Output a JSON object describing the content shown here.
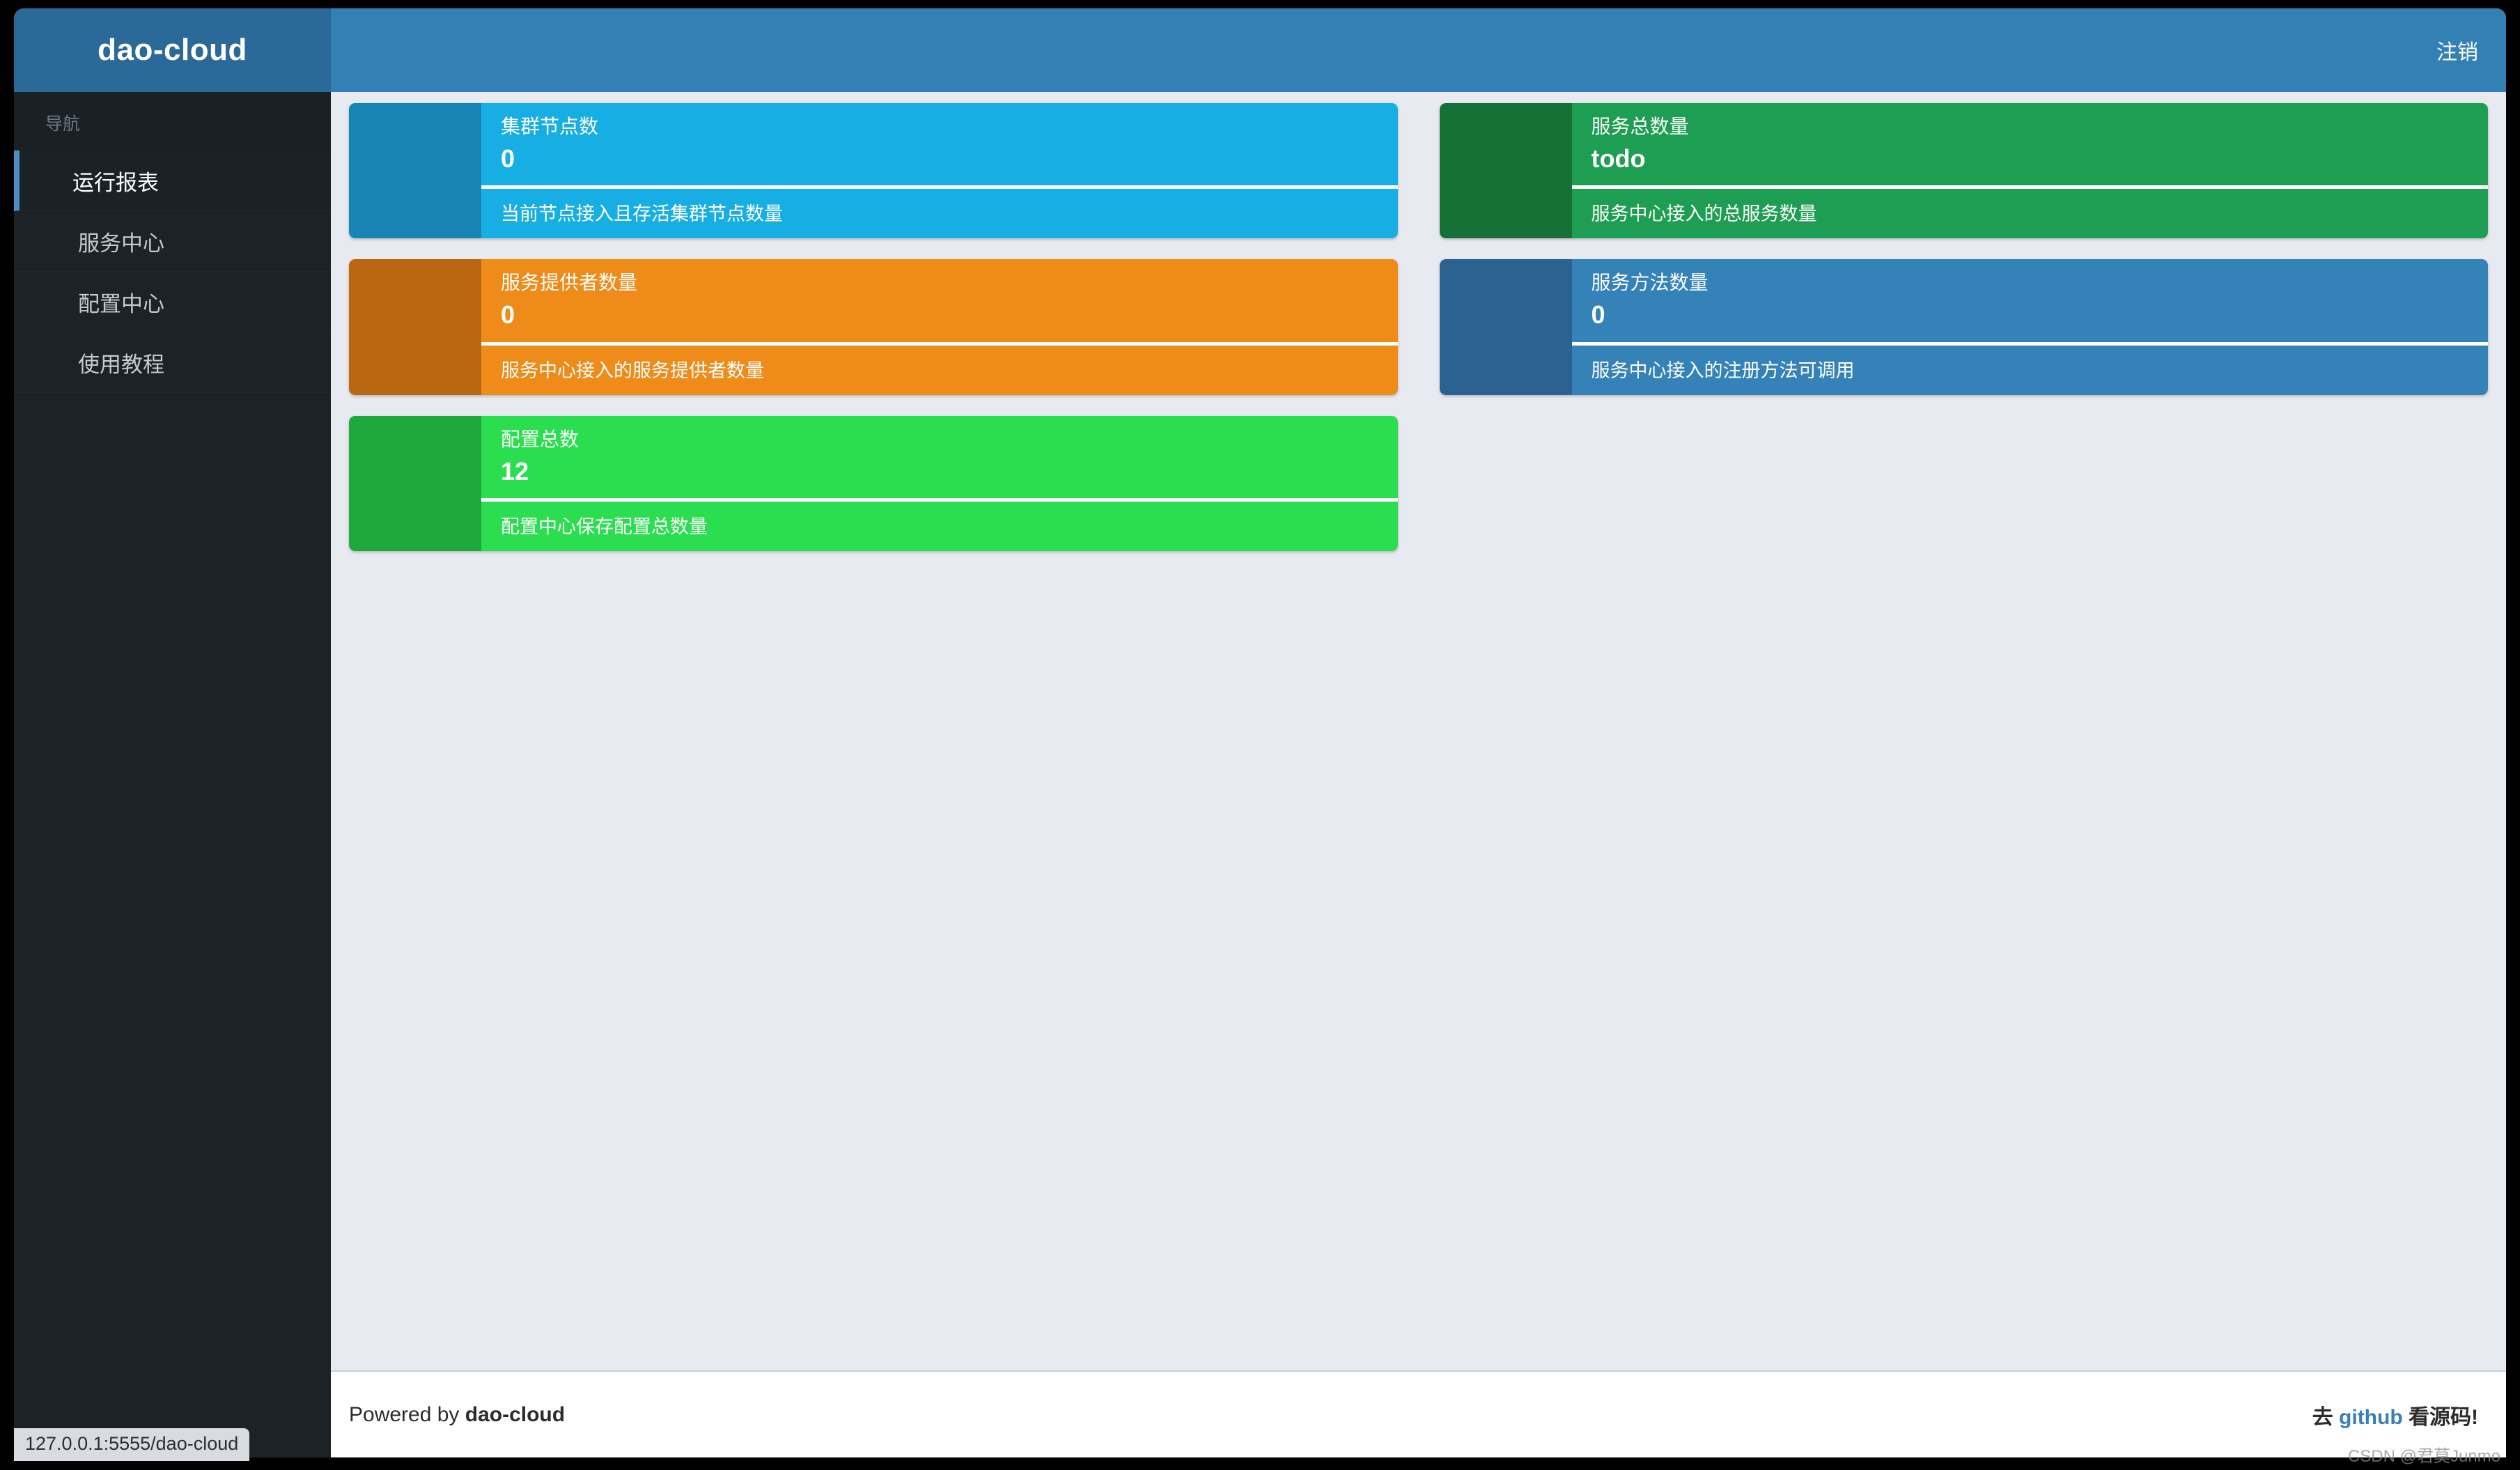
{
  "brand": {
    "title": "dao-cloud"
  },
  "topbar": {
    "logout_label": "注销"
  },
  "sidebar": {
    "nav_heading": "导航",
    "items": [
      {
        "label": "运行报表",
        "active": true
      },
      {
        "label": "服务中心",
        "active": false
      },
      {
        "label": "配置中心",
        "active": false
      },
      {
        "label": "使用教程",
        "active": false
      }
    ]
  },
  "cards": {
    "left": [
      {
        "title": "集群节点数",
        "value": "0",
        "description": "当前节点接入且存活集群节点数量",
        "body_color": "#17aee3",
        "icon_color": "#1785b3"
      },
      {
        "title": "服务提供者数量",
        "value": "0",
        "description": "服务中心接入的服务提供者数量",
        "body_color": "#ee8b19",
        "icon_color": "#b96710"
      },
      {
        "title": "配置总数",
        "value": "12",
        "description": "配置中心保存配置总数量",
        "body_color": "#2ade4f",
        "icon_color": "#1fa93d"
      }
    ],
    "right": [
      {
        "title": "服务总数量",
        "value": "todo",
        "description": "服务中心接入的总服务数量",
        "body_color": "#1d9e52",
        "icon_color": "#157136"
      },
      {
        "title": "服务方法数量",
        "value": "0",
        "description": "服务中心接入的注册方法可调用",
        "body_color": "#3482b8",
        "icon_color": "#2c6290"
      }
    ]
  },
  "footer": {
    "left_prefix": "Powered by ",
    "left_brand": "dao-cloud",
    "right_prefix": "去 ",
    "right_link": "github",
    "right_suffix": " 看源码!"
  },
  "statusbar": {
    "url": "127.0.0.1:5555/dao-cloud"
  },
  "watermark": {
    "text": "CSDN @君莫Junmo"
  },
  "colors": {
    "topbar": "#3380b5",
    "brand_bar": "#2a6998",
    "sidebar": "#1c2226",
    "content_bg": "#e8eaf1",
    "accent": "#4a90c4"
  }
}
